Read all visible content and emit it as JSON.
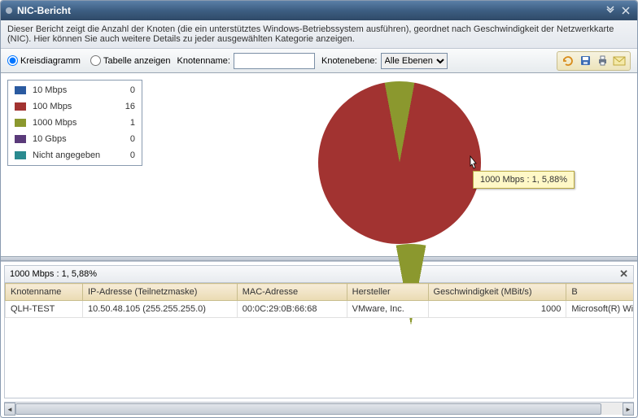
{
  "window": {
    "title": "NIC-Bericht"
  },
  "description": "Dieser Bericht zeigt die Anzahl der Knoten (die ein unterstütztes Windows-Betriebssystem ausführen), geordnet nach Geschwindigkeit der Netzwerkkarte (NIC). Hier können Sie auch weitere Details zu jeder ausgewählten Kategorie anzeigen.",
  "toolbar": {
    "view_pie": "Kreisdiagramm",
    "view_table": "Tabelle anzeigen",
    "nodename_label": "Knotenname:",
    "nodename_value": "",
    "nodelevel_label": "Knotenebene:",
    "nodelevel_value": "Alle Ebenen"
  },
  "chart_data": {
    "type": "pie",
    "title": "",
    "categories": [
      "10 Mbps",
      "100 Mbps",
      "1000 Mbps",
      "10 Gbps",
      "Nicht angegeben"
    ],
    "values": [
      0,
      16,
      1,
      0,
      0
    ],
    "colors": [
      "#2a5aa0",
      "#a23331",
      "#8b982e",
      "#5a3a7a",
      "#2a8a8f"
    ],
    "exploded_index": 2,
    "legend_position": "top-left"
  },
  "legend": [
    {
      "label": "10 Mbps",
      "value": "0",
      "color": "#2a5aa0"
    },
    {
      "label": "100 Mbps",
      "value": "16",
      "color": "#a23331"
    },
    {
      "label": "1000 Mbps",
      "value": "1",
      "color": "#8b982e"
    },
    {
      "label": "10 Gbps",
      "value": "0",
      "color": "#5a3a7a"
    },
    {
      "label": "Nicht angegeben",
      "value": "0",
      "color": "#2a8a8f"
    }
  ],
  "tooltip": "1000 Mbps : 1, 5,88%",
  "detail": {
    "title": "1000 Mbps : 1, 5,88%",
    "columns": [
      "Knotenname",
      "IP-Adresse (Teilnetzmaske)",
      "MAC-Adresse",
      "Hersteller",
      "Geschwindigkeit (MBit/s)",
      "B"
    ],
    "rows": [
      {
        "c0": "QLH-TEST",
        "c1": "10.50.48.105 (255.255.255.0)",
        "c2": "00:0C:29:0B:66:68",
        "c3": "VMware, Inc.",
        "c4": "1000",
        "c5": "Microsoft(R) Windo"
      }
    ]
  }
}
